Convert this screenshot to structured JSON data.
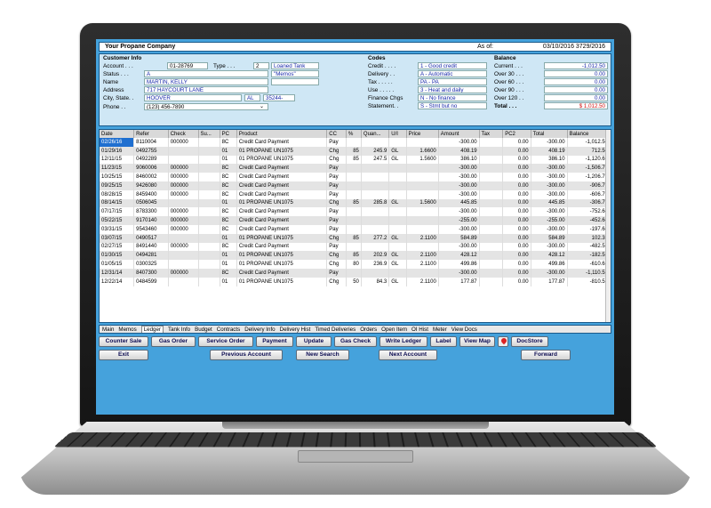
{
  "header": {
    "company": "Your Propane Company",
    "as_of_label": "As of:",
    "as_of_value": "03/10/2016   3729/2016"
  },
  "customer": {
    "section_label": "Customer Info",
    "account_label": "Account . . .",
    "account": "01-28769",
    "type_label": "Type . . .",
    "type": "2",
    "type_desc": "Loaned Tank",
    "memos": "\"Memos\"",
    "status_label": "Status . . .",
    "status": "A",
    "name_label": "Name",
    "name": "MARTIN, KELLY",
    "address_label": "Address",
    "address": "717 HAYCOURT LANE",
    "city_label": "City, State. .",
    "city": "HOOVER",
    "state": "AL",
    "zip": "35244-",
    "phone_label": "Phone . .",
    "phone": "(123) 456-7890"
  },
  "codes": {
    "section_label": "Codes",
    "rows": [
      {
        "label": "Credit . . . .",
        "value": "1 - Good credit"
      },
      {
        "label": "Delivery . .",
        "value": "A - Automatic"
      },
      {
        "label": "Tax . . . . .",
        "value": "PA - PA_"
      },
      {
        "label": "Use . . . . .",
        "value": "3 - Heat and daily"
      },
      {
        "label": "Finance Chgs",
        "value": "N - No finance"
      },
      {
        "label": "Statement. .",
        "value": "S - Stmt but no"
      }
    ]
  },
  "balance": {
    "section_label": "Balance",
    "rows": [
      {
        "label": "Current . . .",
        "value": "-1,012.50"
      },
      {
        "label": "Over 30 . . .",
        "value": "0.00"
      },
      {
        "label": "Over 60 . . .",
        "value": "0.00"
      },
      {
        "label": "Over 90 . . .",
        "value": "0.00"
      },
      {
        "label": "Over 120 . .",
        "value": "0.00"
      },
      {
        "label": "Total . . .",
        "value": "$ 1,012.50"
      }
    ],
    "total_color": "#d01010"
  },
  "ledger": {
    "columns": [
      "Date",
      "Refer",
      "Check",
      "Su...",
      "PC",
      "Product",
      "CC",
      "%",
      "Quan...",
      "U/I",
      "Price",
      "Amount",
      "Tax",
      "PC2",
      "Total",
      "Balance"
    ],
    "rows": [
      [
        "02/26/16",
        "8110004",
        "000000",
        "",
        "8C",
        "Credit Card Payment",
        "Pay",
        "",
        "",
        "",
        "",
        "-300.00",
        "",
        "0.00",
        "-300.00",
        "-1,012.50"
      ],
      [
        "01/29/16",
        "0492755",
        "",
        "",
        "01",
        "01  PROPANE UN1075",
        "Chg",
        "85",
        "245.9",
        "GL",
        "1.6600",
        "408.19",
        "",
        "0.00",
        "408.19",
        "712.50"
      ],
      [
        "12/11/15",
        "0492289",
        "",
        "",
        "01",
        "01  PROPANE UN1075",
        "Chg",
        "85",
        "247.5",
        "GL",
        "1.5600",
        "386.10",
        "",
        "0.00",
        "386.10",
        "-1,120.69"
      ],
      [
        "11/23/15",
        "9060006",
        "000000",
        "",
        "8C",
        "Credit Card Payment",
        "Pay",
        "",
        "",
        "",
        "",
        "-300.00",
        "",
        "0.00",
        "-300.00",
        "-1,506.79"
      ],
      [
        "10/25/15",
        "8460002",
        "000000",
        "",
        "8C",
        "Credit Card Payment",
        "Pay",
        "",
        "",
        "",
        "",
        "-300.00",
        "",
        "0.00",
        "-300.00",
        "-1,206.79"
      ],
      [
        "09/25/15",
        "9426080",
        "000000",
        "",
        "8C",
        "Credit Card Payment",
        "Pay",
        "",
        "",
        "",
        "",
        "-300.00",
        "",
        "0.00",
        "-300.00",
        "-906.79"
      ],
      [
        "08/28/15",
        "8459400",
        "000000",
        "",
        "8C",
        "Credit Card Payment",
        "Pay",
        "",
        "",
        "",
        "",
        "-300.00",
        "",
        "0.00",
        "-300.00",
        "-606.79"
      ],
      [
        "08/14/15",
        "0506045",
        "",
        "",
        "01",
        "01  PROPANE UN1075",
        "Chg",
        "85",
        "285.8",
        "GL",
        "1.5600",
        "445.85",
        "",
        "0.00",
        "445.85",
        "-306.79"
      ],
      [
        "07/17/15",
        "8783300",
        "000000",
        "",
        "8C",
        "Credit Card Payment",
        "Pay",
        "",
        "",
        "",
        "",
        "-300.00",
        "",
        "0.00",
        "-300.00",
        "-752.64"
      ],
      [
        "05/22/15",
        "9170140",
        "000000",
        "",
        "8C",
        "Credit Card Payment",
        "Pay",
        "",
        "",
        "",
        "",
        "-255.00",
        "",
        "0.00",
        "-255.00",
        "-452.64"
      ],
      [
        "03/31/15",
        "9543460",
        "000000",
        "",
        "8C",
        "Credit Card Payment",
        "Pay",
        "",
        "",
        "",
        "",
        "-300.00",
        "",
        "0.00",
        "-300.00",
        "-197.64"
      ],
      [
        "03/07/15",
        "0490517",
        "",
        "",
        "01",
        "01  PROPANE UN1075",
        "Chg",
        "85",
        "277.2",
        "GL",
        "2.1100",
        "584.89",
        "",
        "0.00",
        "584.89",
        "102.36"
      ],
      [
        "02/27/15",
        "8491440",
        "000000",
        "",
        "8C",
        "Credit Card Payment",
        "Pay",
        "",
        "",
        "",
        "",
        "-300.00",
        "",
        "0.00",
        "-300.00",
        "-482.53"
      ],
      [
        "01/30/15",
        "0494281",
        "",
        "",
        "01",
        "01  PROPANE UN1075",
        "Chg",
        "85",
        "202.9",
        "GL",
        "2.1100",
        "428.12",
        "",
        "0.00",
        "428.12",
        "-182.53"
      ],
      [
        "01/05/15",
        "0300325",
        "",
        "",
        "01",
        "01  PROPANE UN1075",
        "Chg",
        "80",
        "236.9",
        "GL",
        "2.1100",
        "499.86",
        "",
        "0.00",
        "499.86",
        "-610.65"
      ],
      [
        "12/31/14",
        "8407300",
        "000000",
        "",
        "8C",
        "Credit Card Payment",
        "Pay",
        "",
        "",
        "",
        "",
        "-300.00",
        "",
        "0.00",
        "-300.00",
        "-1,110.51"
      ],
      [
        "12/22/14",
        "0484599",
        "",
        "",
        "01",
        "01  PROPANE UN1075",
        "Chg",
        "50",
        "84.3",
        "GL",
        "2.1100",
        "177.87",
        "",
        "0.00",
        "177.87",
        "-810.51"
      ]
    ]
  },
  "tabs": [
    "Main",
    "Memos",
    "Ledger",
    "Tank Info",
    "Budget",
    "Contracts",
    "Delivery Info",
    "Delivery Hist",
    "Timed Deliveries",
    "Orders",
    "Open Item",
    "OI Hist",
    "Meter",
    "View Docs"
  ],
  "buttons": {
    "counter_sale": "Counter Sale",
    "gas_order": "Gas Order",
    "service_order": "Service Order",
    "payment": "Payment",
    "update": "Update",
    "gas_check": "Gas Check",
    "write_ledger": "Write Ledger",
    "label": "Label",
    "view_map": "View Map",
    "docstore": "DocStore",
    "exit": "Exit",
    "previous_account": "Previous Account",
    "new_search": "New Search",
    "next_account": "Next Account",
    "forward": "Forward"
  }
}
